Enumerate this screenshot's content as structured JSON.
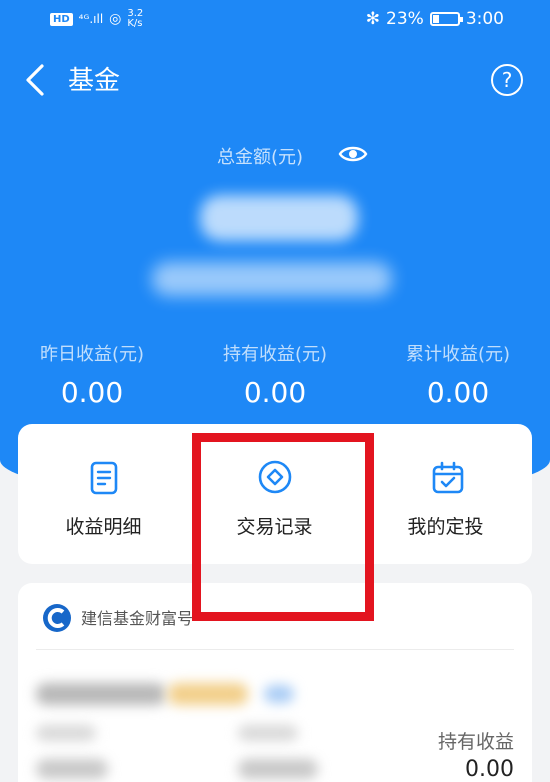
{
  "status_bar": {
    "hd_badge": "HD",
    "signal": "⁴ᴳ.ıll",
    "wifi": "◎",
    "speed_value": "3.2",
    "speed_unit": "K/s",
    "bluetooth": "✻",
    "battery_percent": "23%",
    "battery_level": 0.23,
    "time": "3:00"
  },
  "header": {
    "back_icon": "chevron-left-icon",
    "title": "基金",
    "help_icon": "?"
  },
  "summary": {
    "total_label": "总金额(元)",
    "eye_icon": "eye-icon"
  },
  "stats": [
    {
      "label": "昨日收益(元)",
      "value": "0.00"
    },
    {
      "label": "持有收益(元)",
      "value": "0.00"
    },
    {
      "label": "累计收益(元)",
      "value": "0.00"
    }
  ],
  "actions": [
    {
      "label": "收益明细",
      "icon": "document-icon"
    },
    {
      "label": "交易记录",
      "icon": "diamond-circle-icon"
    },
    {
      "label": "我的定投",
      "icon": "calendar-check-icon"
    }
  ],
  "fund": {
    "bank_name": "建信基金财富号",
    "holding_label": "持有收益",
    "holding_value": "0.00"
  },
  "colors": {
    "brand_blue": "#1e88f6",
    "highlight_red": "#e3141f"
  }
}
